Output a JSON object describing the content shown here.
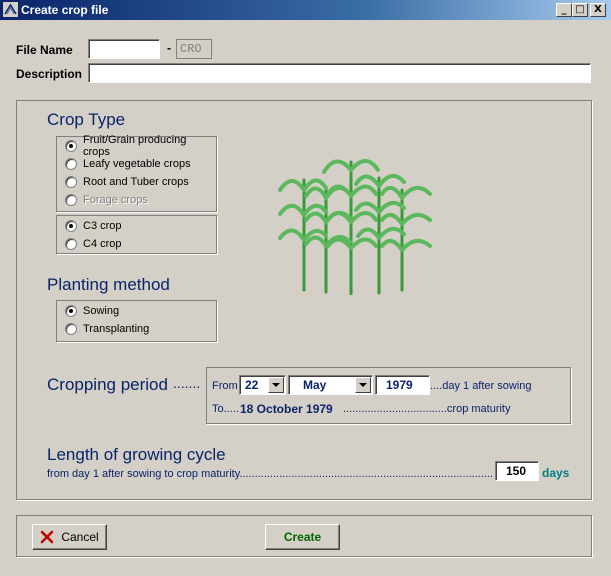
{
  "window": {
    "title": "Create crop file",
    "minimize": "_",
    "maximize": "□",
    "close": "X"
  },
  "file": {
    "name_label": "File Name",
    "name_value": "",
    "dash": "-",
    "extension": "CRO",
    "desc_label": "Description",
    "desc_value": ""
  },
  "crop_type": {
    "heading": "Crop Type",
    "options": [
      {
        "label": "Fruit/Grain producing crops",
        "selected": true,
        "disabled": false
      },
      {
        "label": "Leafy vegetable crops",
        "selected": false,
        "disabled": false
      },
      {
        "label": "Root and Tuber crops",
        "selected": false,
        "disabled": false
      },
      {
        "label": "Forage crops",
        "selected": false,
        "disabled": true
      }
    ],
    "photo_options": [
      {
        "label": "C3 crop",
        "selected": true
      },
      {
        "label": "C4 crop",
        "selected": false
      }
    ]
  },
  "planting": {
    "heading": "Planting method",
    "options": [
      {
        "label": "Sowing",
        "selected": true
      },
      {
        "label": "Transplanting",
        "selected": false
      }
    ]
  },
  "cropping_period": {
    "heading": "Cropping period",
    "dots": ".......",
    "from_label": "From",
    "day": "22",
    "month": "May",
    "year": "1979",
    "day1_text": "....day 1 after sowing",
    "to_text": "To.....",
    "to_date": "18 October 1979",
    "maturity_text": "..................................crop maturity"
  },
  "growing_cycle": {
    "heading": "Length of growing cycle",
    "description": "from day 1 after sowing to crop maturity......................................................................................................................",
    "value": "150",
    "unit": "days"
  },
  "buttons": {
    "cancel": "Cancel",
    "create": "Create"
  },
  "colors": {
    "heading": "#0a246a",
    "days": "#008080",
    "cancel_icon": "#c00000",
    "plant": "#3a9a3a"
  }
}
